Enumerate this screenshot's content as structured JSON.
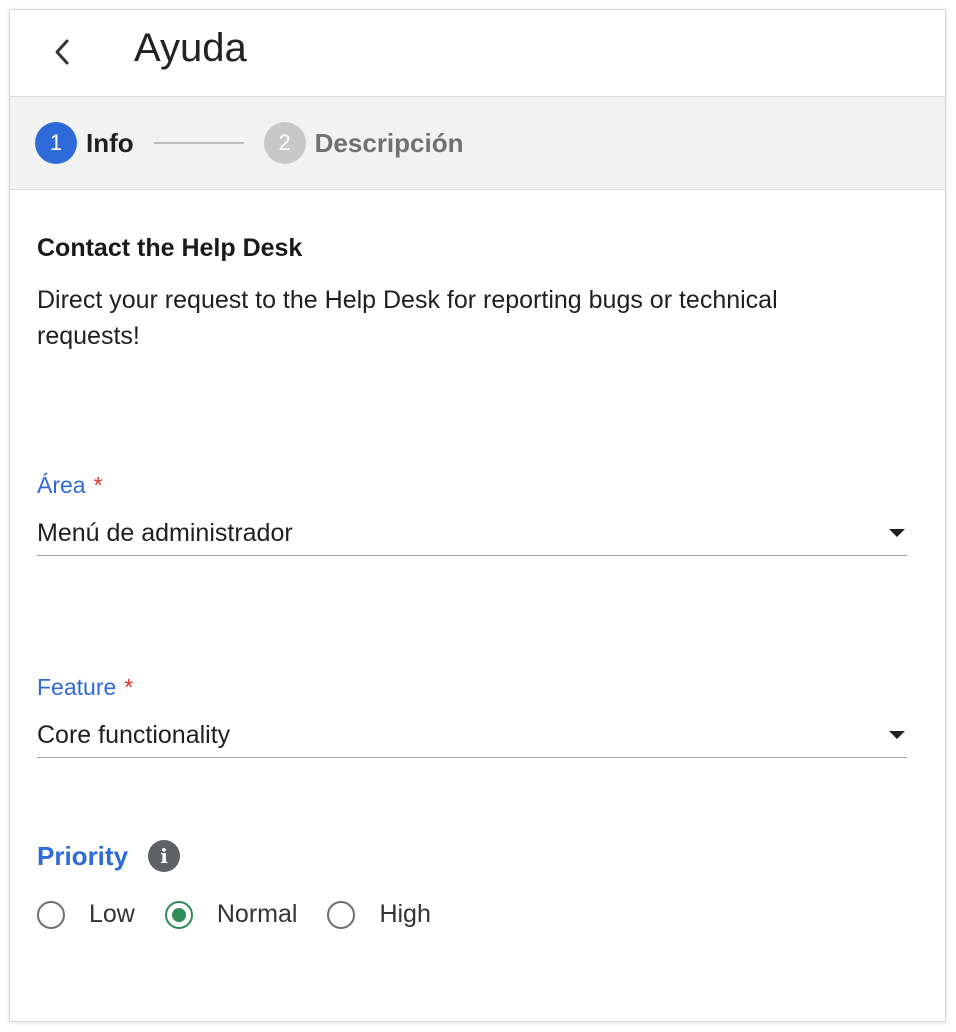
{
  "header": {
    "title": "Ayuda",
    "back_icon": "chevron-left-icon"
  },
  "stepper": {
    "steps": [
      {
        "number": "1",
        "label": "Info",
        "state": "active"
      },
      {
        "number": "2",
        "label": "Descripción",
        "state": "inactive"
      }
    ]
  },
  "intro": {
    "heading": "Contact the Help Desk",
    "text": "Direct your request to the Help Desk for reporting bugs or technical requests!"
  },
  "fields": {
    "area": {
      "label": "Área",
      "required_mark": "*",
      "value": "Menú de administrador"
    },
    "feature": {
      "label": "Feature",
      "required_mark": "*",
      "value": "Core functionality"
    }
  },
  "priority": {
    "label": "Priority",
    "info_icon": "info-icon",
    "options": [
      {
        "label": "Low",
        "checked": false
      },
      {
        "label": "Normal",
        "checked": true
      },
      {
        "label": "High",
        "checked": false
      }
    ]
  },
  "colors": {
    "accent": "#2f6bd8",
    "radio_checked": "#2e8b57",
    "required": "#d93025"
  }
}
